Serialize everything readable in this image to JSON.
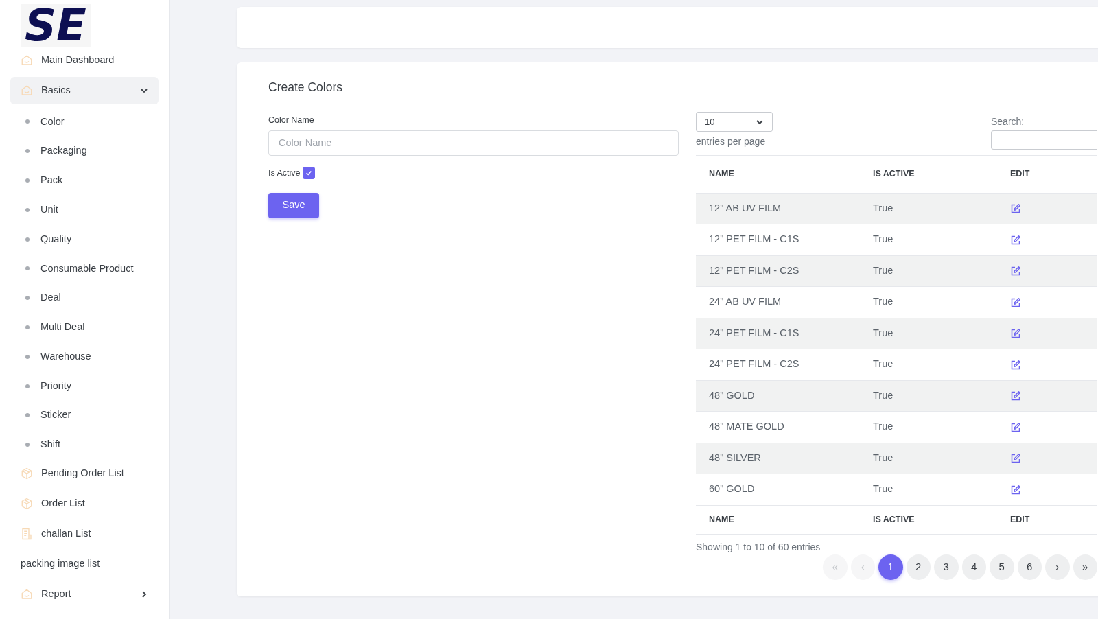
{
  "logo": {
    "text": "SE"
  },
  "sidebar": {
    "items": [
      {
        "kind": "link",
        "label": "Main Dashboard",
        "selected": false
      },
      {
        "kind": "group",
        "label": "Basics",
        "expanded": true,
        "selected": true,
        "children": [
          {
            "label": "Color"
          },
          {
            "label": "Packaging"
          },
          {
            "label": "Pack"
          },
          {
            "label": "Unit"
          },
          {
            "label": "Quality"
          },
          {
            "label": "Consumable Product"
          },
          {
            "label": "Deal"
          },
          {
            "label": "Multi Deal"
          },
          {
            "label": "Warehouse"
          },
          {
            "label": "Priority"
          },
          {
            "label": "Sticker"
          },
          {
            "label": "Shift"
          }
        ]
      },
      {
        "kind": "link",
        "label": "Pending Order List",
        "selected": false
      },
      {
        "kind": "link",
        "label": "Order List",
        "selected": false
      },
      {
        "kind": "link",
        "label": "challan List",
        "selected": false
      },
      {
        "kind": "plain",
        "label": "packing image list",
        "selected": false
      },
      {
        "kind": "group",
        "label": "Report",
        "expanded": false,
        "selected": false
      }
    ]
  },
  "form": {
    "title": "Create Colors",
    "name_label": "Color Name",
    "name_placeholder": "Color Name",
    "active_label": "Is Active",
    "active_checked": true,
    "save": "Save"
  },
  "table": {
    "page_size": "10",
    "page_size_label": "entries per page",
    "search_label": "Search:",
    "columns": [
      "NAME",
      "IS ACTIVE",
      "EDIT"
    ],
    "rows": [
      {
        "name": "12\" AB UV FILM",
        "active": "True"
      },
      {
        "name": "12\" PET FILM - C1S",
        "active": "True"
      },
      {
        "name": "12\" PET FILM - C2S",
        "active": "True"
      },
      {
        "name": "24\" AB UV FILM",
        "active": "True"
      },
      {
        "name": "24\" PET FILM - C1S",
        "active": "True"
      },
      {
        "name": "24\" PET FILM - C2S",
        "active": "True"
      },
      {
        "name": "48\" GOLD",
        "active": "True"
      },
      {
        "name": "48\" MATE GOLD",
        "active": "True"
      },
      {
        "name": "48\" SILVER",
        "active": "True"
      },
      {
        "name": "60\" GOLD",
        "active": "True"
      }
    ],
    "footer_columns": [
      "NAME",
      "IS ACTIVE",
      "EDIT"
    ],
    "info": "Showing 1 to 10 of 60 entries",
    "pages": [
      {
        "label": "«",
        "selected": false,
        "disabled": true
      },
      {
        "label": "‹",
        "selected": false,
        "disabled": true
      },
      {
        "label": "1",
        "selected": true,
        "disabled": false
      },
      {
        "label": "2",
        "selected": false,
        "disabled": false
      },
      {
        "label": "3",
        "selected": false,
        "disabled": false
      },
      {
        "label": "4",
        "selected": false,
        "disabled": false
      },
      {
        "label": "5",
        "selected": false,
        "disabled": false
      },
      {
        "label": "6",
        "selected": false,
        "disabled": false
      },
      {
        "label": "›",
        "selected": false,
        "disabled": false
      },
      {
        "label": "»",
        "selected": false,
        "disabled": false
      }
    ]
  }
}
